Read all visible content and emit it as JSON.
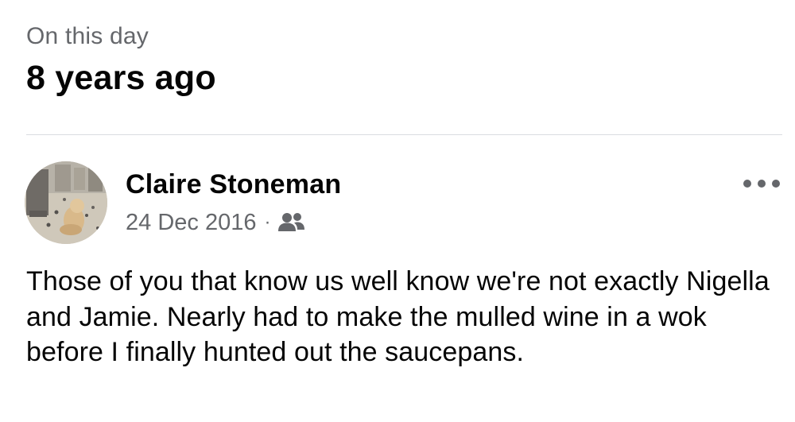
{
  "memory": {
    "label": "On this day",
    "title": "8 years ago"
  },
  "post": {
    "author": "Claire Stoneman",
    "date": "24 Dec 2016",
    "separator": "·",
    "audience_icon": "friends-icon",
    "more_icon": "more-options-icon",
    "text": "Those of you that know us well know we're not exactly Nigella and Jamie. Nearly had to make the mulled wine in a wok before I finally hunted out the saucepans."
  },
  "colors": {
    "primary_text": "#050505",
    "secondary_text": "#65676b",
    "divider": "#dadde1"
  }
}
